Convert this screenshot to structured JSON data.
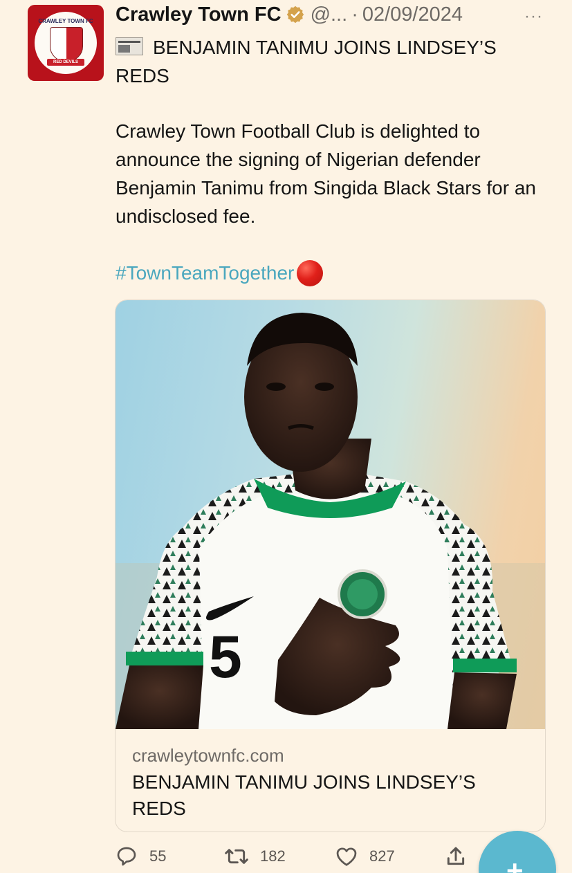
{
  "tweet": {
    "author_name": "Crawley Town FC",
    "handle": "@...",
    "separator": "·",
    "date": "02/09/2024",
    "more_label": "···",
    "headline": "BENJAMIN TANIMU JOINS LINDSEY’S REDS",
    "body": "Crawley Town Football Club is delighted to announce the signing of Nigerian defender Benjamin Tanimu from Singida Black Stars for an undisclosed fee.",
    "hashtag": "#TownTeamTogether"
  },
  "avatar": {
    "ring_text": "CRAWLEY TOWN FC",
    "banner_text": "RED DEVILS"
  },
  "card": {
    "domain": "crawleytownfc.com",
    "title": "BENJAMIN TANIMU JOINS LINDSEY’S REDS",
    "jersey_number": "5"
  },
  "actions": {
    "replies": "55",
    "reposts": "182",
    "likes": "827"
  },
  "fab": {
    "label": "+"
  },
  "colors": {
    "background": "#fdf3e4",
    "hashtag": "#4aa7be",
    "verified_badge": "#d4a24c",
    "fab": "#5bb8cf",
    "avatar_bg": "#b8121b"
  },
  "icons": {
    "verified": "verified-badge-icon",
    "newspaper": "newspaper-icon",
    "red_circle": "red-circle-emoji-icon",
    "reply": "reply-icon",
    "repost": "repost-icon",
    "like": "heart-icon",
    "share": "share-icon",
    "more": "more-icon",
    "compose": "plus-icon"
  }
}
